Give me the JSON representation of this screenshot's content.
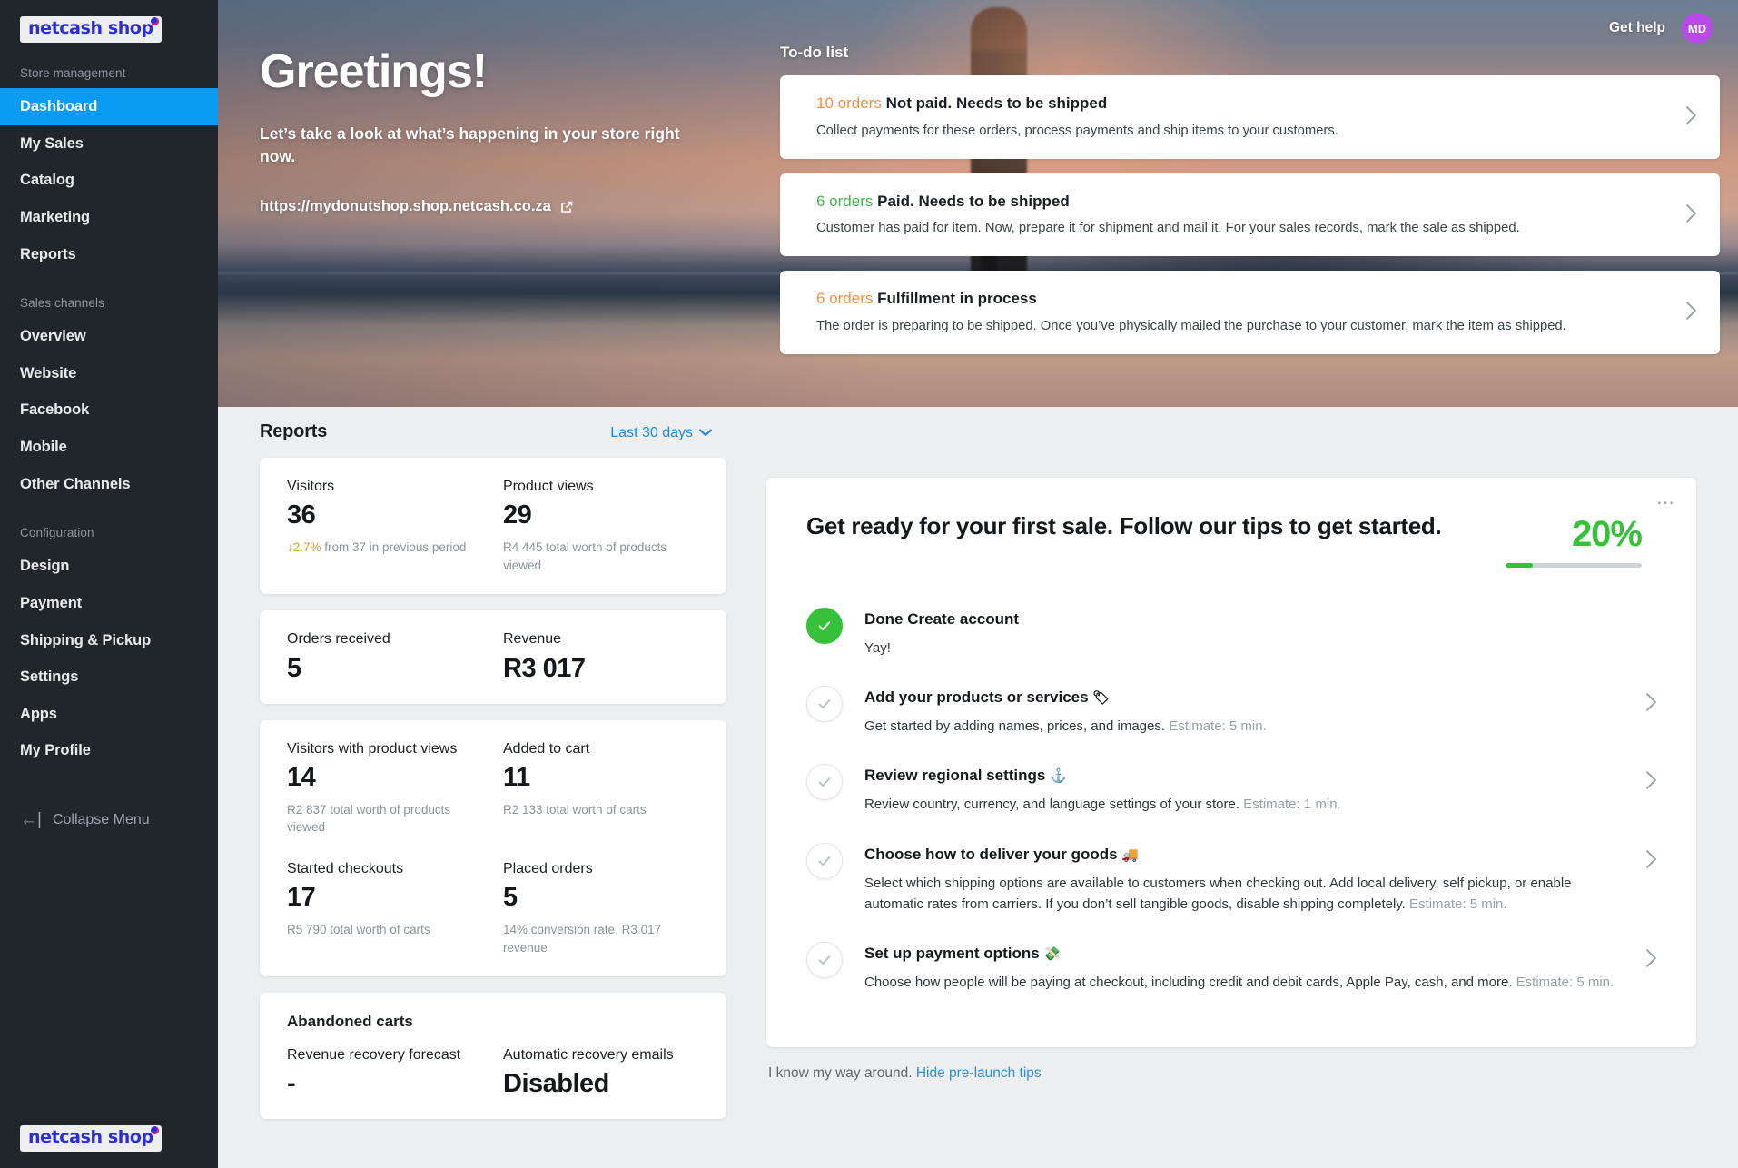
{
  "sidebar": {
    "logo": "netcash shop",
    "sections": [
      {
        "label": "Store management",
        "items": [
          {
            "label": "Dashboard",
            "active": true
          },
          {
            "label": "My Sales",
            "active": false
          },
          {
            "label": "Catalog",
            "active": false
          },
          {
            "label": "Marketing",
            "active": false
          },
          {
            "label": "Reports",
            "active": false
          }
        ]
      },
      {
        "label": "Sales channels",
        "items": [
          {
            "label": "Overview",
            "active": false
          },
          {
            "label": "Website",
            "active": false
          },
          {
            "label": "Facebook",
            "active": false
          },
          {
            "label": "Mobile",
            "active": false
          },
          {
            "label": "Other Channels",
            "active": false
          }
        ]
      },
      {
        "label": "Configuration",
        "items": [
          {
            "label": "Design",
            "active": false
          },
          {
            "label": "Payment",
            "active": false
          },
          {
            "label": "Shipping & Pickup",
            "active": false
          },
          {
            "label": "Settings",
            "active": false
          },
          {
            "label": "Apps",
            "active": false
          },
          {
            "label": "My Profile",
            "active": false
          }
        ]
      }
    ],
    "collapse_label": "Collapse Menu",
    "collapse_icon": "arrow-left-bar-icon"
  },
  "topbar": {
    "get_help": "Get help",
    "avatar_initials": "MD",
    "avatar_color": "#b84ae8"
  },
  "hero": {
    "title": "Greetings!",
    "subtitle": "Let’s take a look at what’s happening in your store right now.",
    "store_url": "https://mydonutshop.shop.netcash.co.za",
    "external_link_icon": "external-link-icon"
  },
  "todo": {
    "title": "To-do list",
    "items": [
      {
        "count": "10 orders",
        "count_color": "orange",
        "heading": "Not paid. Needs to be shipped",
        "desc": "Collect payments for these orders, process payments and ship items to your customers."
      },
      {
        "count": "6 orders",
        "count_color": "green",
        "heading": "Paid. Needs to be shipped",
        "desc": "Customer has paid for item. Now, prepare it for shipment and mail it. For your sales records, mark the sale as shipped."
      },
      {
        "count": "6 orders",
        "count_color": "orange",
        "heading": "Fulfillment in process",
        "desc": "The order is preparing to be shipped. Once you’ve physically mailed the purchase to your customer, mark the item as shipped."
      }
    ]
  },
  "reports": {
    "title": "Reports",
    "period": "Last 30 days",
    "period_icon": "chevron-down-icon",
    "card1": [
      {
        "label": "Visitors",
        "value": "36",
        "note_down": "↓2.7%",
        "note": " from 37 in previous period"
      },
      {
        "label": "Product views",
        "value": "29",
        "note_down": "",
        "note": "R4 445 total worth of products viewed"
      }
    ],
    "card2": [
      {
        "label": "Orders received",
        "value": "5",
        "note": ""
      },
      {
        "label": "Revenue",
        "value": "R3 017",
        "note": ""
      }
    ],
    "card3": [
      {
        "label": "Visitors with product views",
        "value": "14",
        "note": "R2 837 total worth of products viewed"
      },
      {
        "label": "Added to cart",
        "value": "11",
        "note": "R2 133 total worth of carts"
      },
      {
        "label": "Started checkouts",
        "value": "17",
        "note": "R5 790 total worth of carts"
      },
      {
        "label": "Placed orders",
        "value": "5",
        "note": "14% conversion rate, R3 017 revenue"
      }
    ],
    "abandoned": {
      "title": "Abandoned carts",
      "items": [
        {
          "label": "Revenue recovery forecast",
          "value": "-"
        },
        {
          "label": "Automatic recovery emails",
          "value": "Disabled"
        }
      ]
    }
  },
  "tips": {
    "title": "Get ready for your first sale. Follow our tips to get started.",
    "progress_percent": "20%",
    "progress_value": 20,
    "progress_color": "#35c13a",
    "menu_icon": "more-options-icon",
    "steps": [
      {
        "done": true,
        "title_prefix": "Done ",
        "title_strike": "Create account",
        "emoji": "",
        "desc": "Yay!",
        "estimate": "",
        "has_chevron": false
      },
      {
        "done": false,
        "title_prefix": "Add your products or services ",
        "title_strike": "",
        "emoji": "🏷",
        "desc": "Get started by adding names, prices, and images. ",
        "estimate": "Estimate: 5 min.",
        "has_chevron": true
      },
      {
        "done": false,
        "title_prefix": "Review regional settings ",
        "title_strike": "",
        "emoji": "⚓",
        "desc": "Review country, currency, and language settings of your store. ",
        "estimate": "Estimate: 1 min.",
        "has_chevron": true
      },
      {
        "done": false,
        "title_prefix": "Choose how to deliver your goods ",
        "title_strike": "",
        "emoji": "🚚",
        "desc": "Select which shipping options are available to customers when checking out. Add local delivery, self pickup, or enable automatic rates from carriers. If you don’t sell tangible goods, disable shipping completely. ",
        "estimate": "Estimate: 5 min.",
        "has_chevron": true
      },
      {
        "done": false,
        "title_prefix": "Set up payment options ",
        "title_strike": "",
        "emoji": "💸",
        "desc": "Choose how people will be paying at checkout, including credit and debit cards, Apple Pay, cash, and more. ",
        "estimate": "Estimate: 5 min.",
        "has_chevron": true
      }
    ],
    "footer_text": "I know my way around. ",
    "footer_link": "Hide pre-launch tips"
  }
}
